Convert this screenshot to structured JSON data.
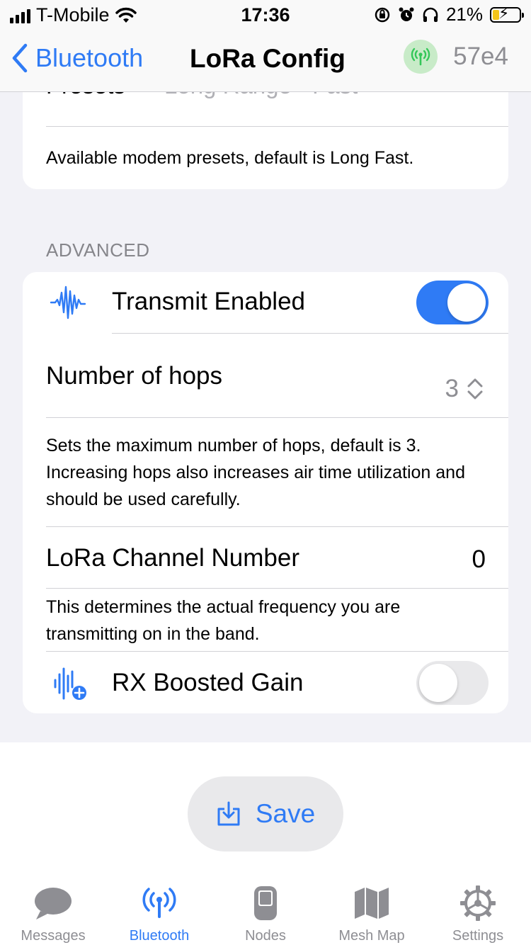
{
  "status_bar": {
    "carrier": "T-Mobile",
    "time": "17:36",
    "battery_percent": "21%"
  },
  "nav": {
    "back_label": "Bluetooth",
    "title": "LoRa Config",
    "node_id": "57e4"
  },
  "presets_card": {
    "partial_label": "Presets",
    "partial_value": "Long Range - Fast",
    "caption": "Available modem presets, default is Long Fast."
  },
  "advanced": {
    "header": "ADVANCED",
    "transmit_enabled": {
      "label": "Transmit Enabled",
      "on": true,
      "icon": "waveform-icon"
    },
    "hops": {
      "label": "Number of hops",
      "value": "3",
      "caption": "Sets the maximum number of hops, default is 3. Increasing hops also increases air time utilization and should be used carefully."
    },
    "channel": {
      "label": "LoRa Channel Number",
      "value": "0",
      "caption": "This determines the actual frequency you are transmitting on in the band."
    },
    "rx_boosted_gain": {
      "label": "RX Boosted Gain",
      "on": false,
      "icon": "waveform-plus-icon"
    }
  },
  "save_button": {
    "label": "Save",
    "icon": "save-tray-icon"
  },
  "tab_bar": {
    "tabs": [
      {
        "label": "Messages",
        "icon": "message-bubble-icon",
        "active": false
      },
      {
        "label": "Bluetooth",
        "icon": "antenna-icon",
        "active": true
      },
      {
        "label": "Nodes",
        "icon": "device-icon",
        "active": false
      },
      {
        "label": "Mesh Map",
        "icon": "map-icon",
        "active": false
      },
      {
        "label": "Settings",
        "icon": "gear-icon",
        "active": false
      }
    ]
  },
  "colors": {
    "accent": "#2f7bf5",
    "toggle_off": "#e9e9eb",
    "secondary_text": "#8e8e93",
    "badge_green": "#34c759"
  }
}
